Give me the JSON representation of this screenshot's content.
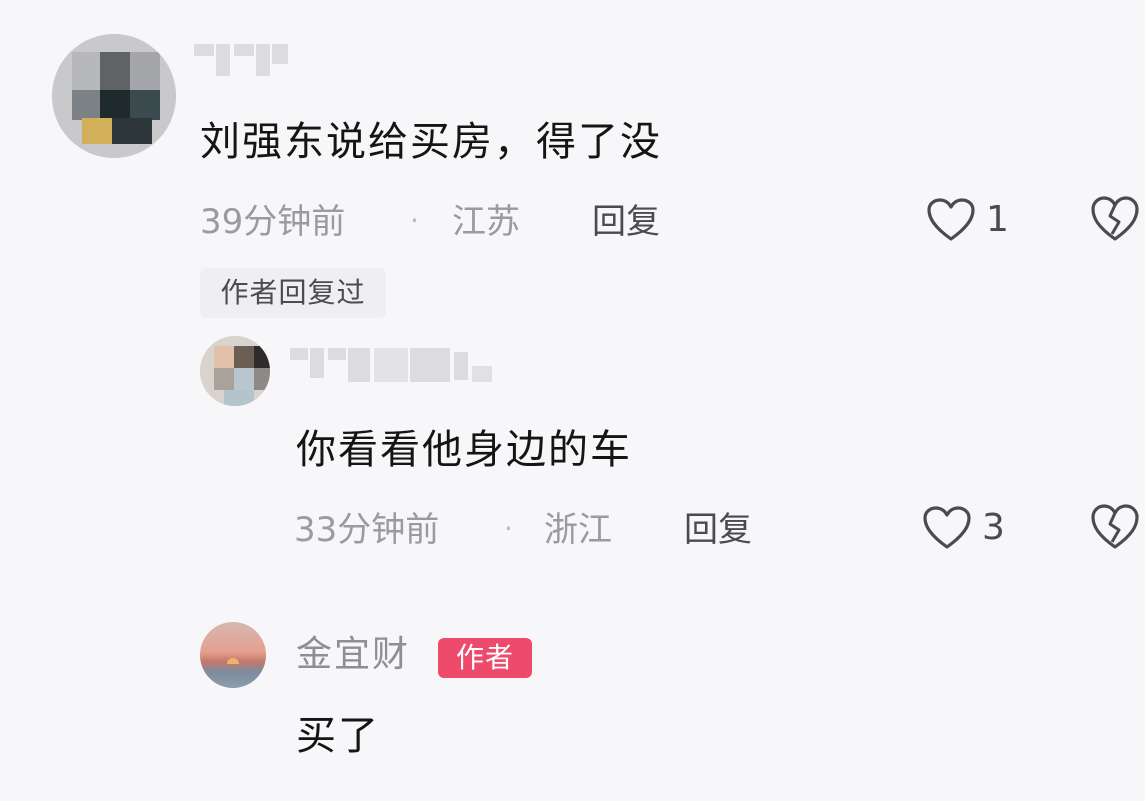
{
  "comments": [
    {
      "text": "刘强东说给买房，得了没",
      "time": "39分钟前",
      "location": "江苏",
      "reply_label": "回复",
      "likes": "1",
      "author_replied_label": "作者回复过"
    }
  ],
  "replies": [
    {
      "text": "你看看他身边的车",
      "time": "33分钟前",
      "location": "浙江",
      "reply_label": "回复",
      "likes": "3"
    },
    {
      "username": "金宜财",
      "badge": "作者",
      "text": "买了"
    }
  ],
  "colors": {
    "author_badge": "#ee4a6b",
    "background": "#f7f7f9",
    "meta_text": "#9a9aa0"
  },
  "icons": [
    "heart-icon",
    "broken-heart-icon"
  ]
}
